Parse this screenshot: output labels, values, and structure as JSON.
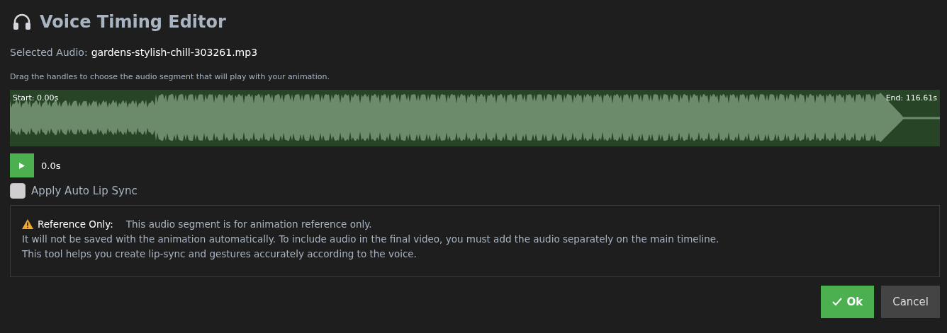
{
  "window": {
    "title": "Voice Timing Editor"
  },
  "selected_audio": {
    "label": "Selected Audio:",
    "value": "gardens-stylish-chill-303261.mp3"
  },
  "instructions": "Drag the handles to choose the audio segment that will play with your animation.",
  "waveform": {
    "start_label": "Start: 0.00s",
    "end_label": "End: 116.61s"
  },
  "player": {
    "time": "0.0s"
  },
  "lip_sync": {
    "label": "Apply Auto Lip Sync",
    "checked": false
  },
  "notice": {
    "heading": "Reference Only:",
    "lines": [
      "This audio segment is for animation reference only.",
      "It will not be saved with the animation automatically. To include audio in the final video, you must add the audio separately on the main timeline.",
      "This tool helps you create lip-sync and gestures accurately according to the voice."
    ]
  },
  "buttons": [
    {
      "label": "Ok",
      "kind": "primary"
    },
    {
      "label": "Cancel",
      "kind": "secondary"
    }
  ]
}
